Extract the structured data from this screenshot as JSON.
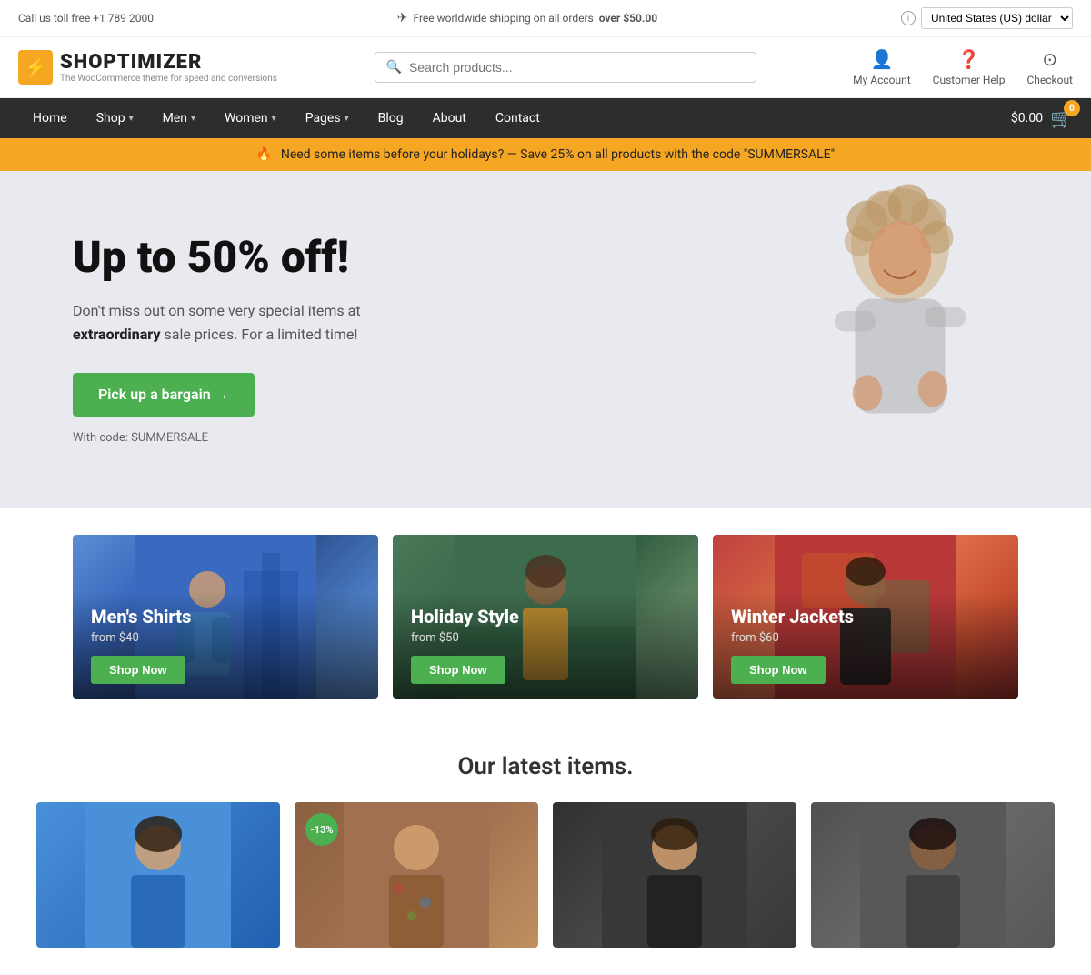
{
  "topbar": {
    "phone": "Call us toll free +1 789 2000",
    "shipping_text": "Free worldwide shipping on all orders",
    "shipping_threshold": "over $50.00",
    "info_icon": "i",
    "currency": "United States (US) dollar"
  },
  "header": {
    "logo_name": "SHOPTIMIZER",
    "logo_tagline": "The WooCommerce theme for speed and conversions",
    "search_placeholder": "Search products...",
    "account_label": "My Account",
    "help_label": "Customer Help",
    "checkout_label": "Checkout"
  },
  "nav": {
    "links": [
      {
        "label": "Home",
        "has_dropdown": false
      },
      {
        "label": "Shop",
        "has_dropdown": true
      },
      {
        "label": "Men",
        "has_dropdown": true
      },
      {
        "label": "Women",
        "has_dropdown": true
      },
      {
        "label": "Pages",
        "has_dropdown": true
      },
      {
        "label": "Blog",
        "has_dropdown": false
      },
      {
        "label": "About",
        "has_dropdown": false
      },
      {
        "label": "Contact",
        "has_dropdown": false
      }
    ],
    "cart_total": "$0.00",
    "cart_count": "0"
  },
  "banner": {
    "icon": "🔥",
    "text": "Need some items before your holidays? — Save 25% on all products with the code \"SUMMERSALE\""
  },
  "hero": {
    "title": "Up to 50% off!",
    "subtitle_1": "Don't miss out on some very special items at",
    "subtitle_bold": "extraordinary",
    "subtitle_2": "sale prices. For a limited time!",
    "button_label": "Pick up a bargain →",
    "code_text": "With code: SUMMERSALE"
  },
  "categories": [
    {
      "title": "Men's Shirts",
      "price": "from $40",
      "button": "Shop Now"
    },
    {
      "title": "Holiday Style",
      "price": "from $50",
      "button": "Shop Now"
    },
    {
      "title": "Winter Jackets",
      "price": "from $60",
      "button": "Shop Now"
    }
  ],
  "latest": {
    "title": "Our latest items.",
    "products": [
      {
        "discount": null
      },
      {
        "discount": "-13%"
      },
      {
        "discount": null
      },
      {
        "discount": null
      }
    ]
  }
}
